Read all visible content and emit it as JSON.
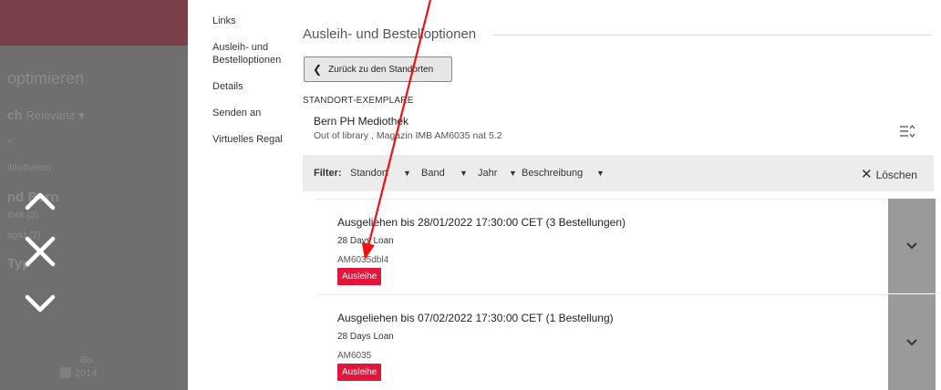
{
  "left_panel": {
    "faded_title": "optimieren",
    "faded_sort": "ch",
    "faded_sort_value": "Relevanz",
    "faded_bibliotheken": "ibliotheken",
    "faded_bern": "nd   Bern",
    "faded_thek": "thek (3)",
    "faded_magazin": "agaz   (2)",
    "faded_typ": "Typ",
    "faded_bis": "Bis",
    "faded_year": "2014",
    "icons": [
      "chevron-up-icon",
      "close-icon",
      "chevron-down-icon"
    ]
  },
  "nav": {
    "links": "Links",
    "ausleih": "Ausleih- und Bestelloptionen",
    "details": "Details",
    "senden": "Senden an",
    "regal": "Virtuelles Regal"
  },
  "main": {
    "title": "Ausleih- und Bestelloptionen",
    "back_label": "Zurück zu den Standorten",
    "section_label": "STANDORT-EXEMPLARE",
    "location_name": "Bern PH Mediothek",
    "location_detail": "Out of library , Magazin IMB AM6035 nat 5.2"
  },
  "filter": {
    "label": "Filter:",
    "standort": "Standort",
    "band": "Band",
    "jahr": "Jahr",
    "beschreibung": "Beschreibung",
    "loeschen": "Löschen"
  },
  "items": [
    {
      "status": "Ausgeliehen bis 28/01/2022 17:30:00 CET (3 Bestellungen)",
      "policy": "28 Days Loan",
      "barcode": "AM6035dbl4",
      "badge": "Ausleihe"
    },
    {
      "status": "Ausgeliehen bis 07/02/2022 17:30:00 CET (1 Bestellung)",
      "policy": "28 Days Loan",
      "barcode": "AM6035",
      "badge": "Ausleihe"
    }
  ],
  "colors": {
    "badge_red": "#e2153b",
    "annotation_red": "#ee1111",
    "overlay_gray": "#6f6f6f",
    "expand_gray": "#9a9a9a"
  }
}
